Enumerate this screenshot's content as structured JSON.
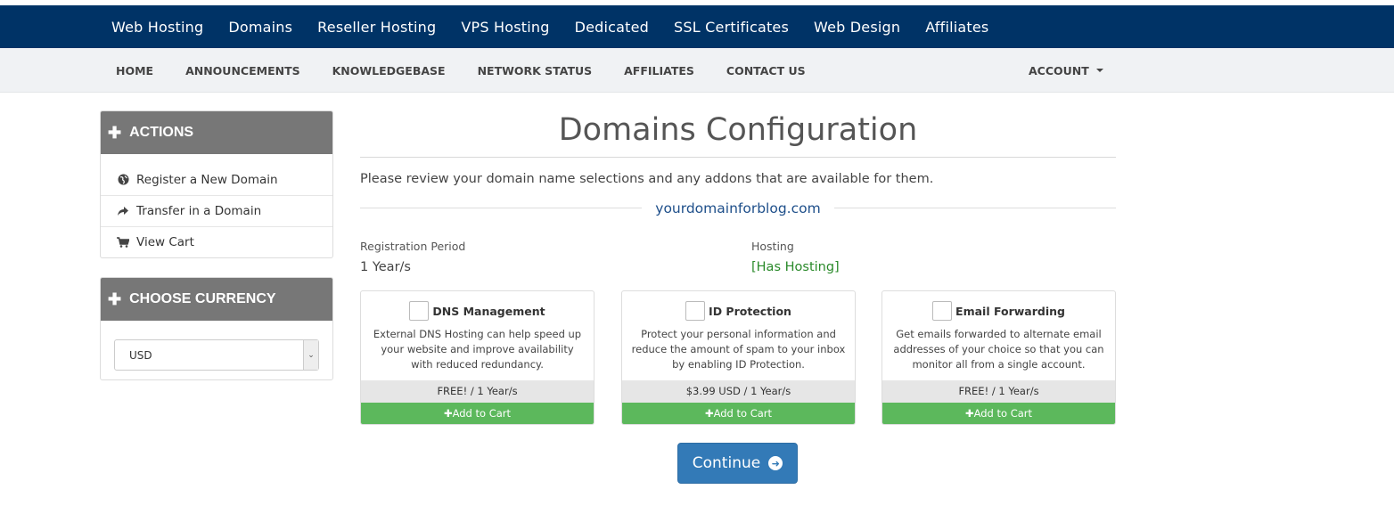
{
  "topnav": {
    "items": [
      "Web Hosting",
      "Domains",
      "Reseller Hosting",
      "VPS Hosting",
      "Dedicated",
      "SSL Certificates",
      "Web Design",
      "Affiliates"
    ]
  },
  "subnav": {
    "items": [
      "HOME",
      "ANNOUNCEMENTS",
      "KNOWLEDGEBASE",
      "NETWORK STATUS",
      "AFFILIATES",
      "CONTACT US"
    ],
    "account": "ACCOUNT"
  },
  "sidebar": {
    "actions": {
      "title": "ACTIONS",
      "items": [
        {
          "label": "Register a New Domain",
          "icon": "globe-icon"
        },
        {
          "label": "Transfer in a Domain",
          "icon": "share-arrow-icon"
        },
        {
          "label": "View Cart",
          "icon": "cart-icon"
        }
      ]
    },
    "currency": {
      "title": "CHOOSE CURRENCY",
      "selected": "USD"
    }
  },
  "main": {
    "title": "Domains Configuration",
    "intro": "Please review your domain name selections and any addons that are available for them.",
    "domain": "yourdomainforblog.com",
    "registration_label": "Registration Period",
    "registration_value": "1 Year/s",
    "hosting_label": "Hosting",
    "hosting_value": "[Has Hosting]",
    "addons": [
      {
        "name": "DNS Management",
        "description": "External DNS Hosting can help speed up your website and improve availability with reduced redundancy.",
        "price": "FREE! / 1 Year/s",
        "button": "Add to Cart"
      },
      {
        "name": "ID Protection",
        "description": "Protect your personal information and reduce the amount of spam to your inbox by enabling ID Protection.",
        "price": "$3.99 USD / 1 Year/s",
        "button": "Add to Cart"
      },
      {
        "name": "Email Forwarding",
        "description": "Get emails forwarded to alternate email addresses of your choice so that you can monitor all from a single account.",
        "price": "FREE! / 1 Year/s",
        "button": "Add to Cart"
      }
    ],
    "continue_label": "Continue"
  },
  "colors": {
    "topbar": "#003366",
    "panel_header": "#777777",
    "add_to_cart": "#5cb85c",
    "primary_button": "#337ab7",
    "hosting_green": "#2a8a2a"
  }
}
